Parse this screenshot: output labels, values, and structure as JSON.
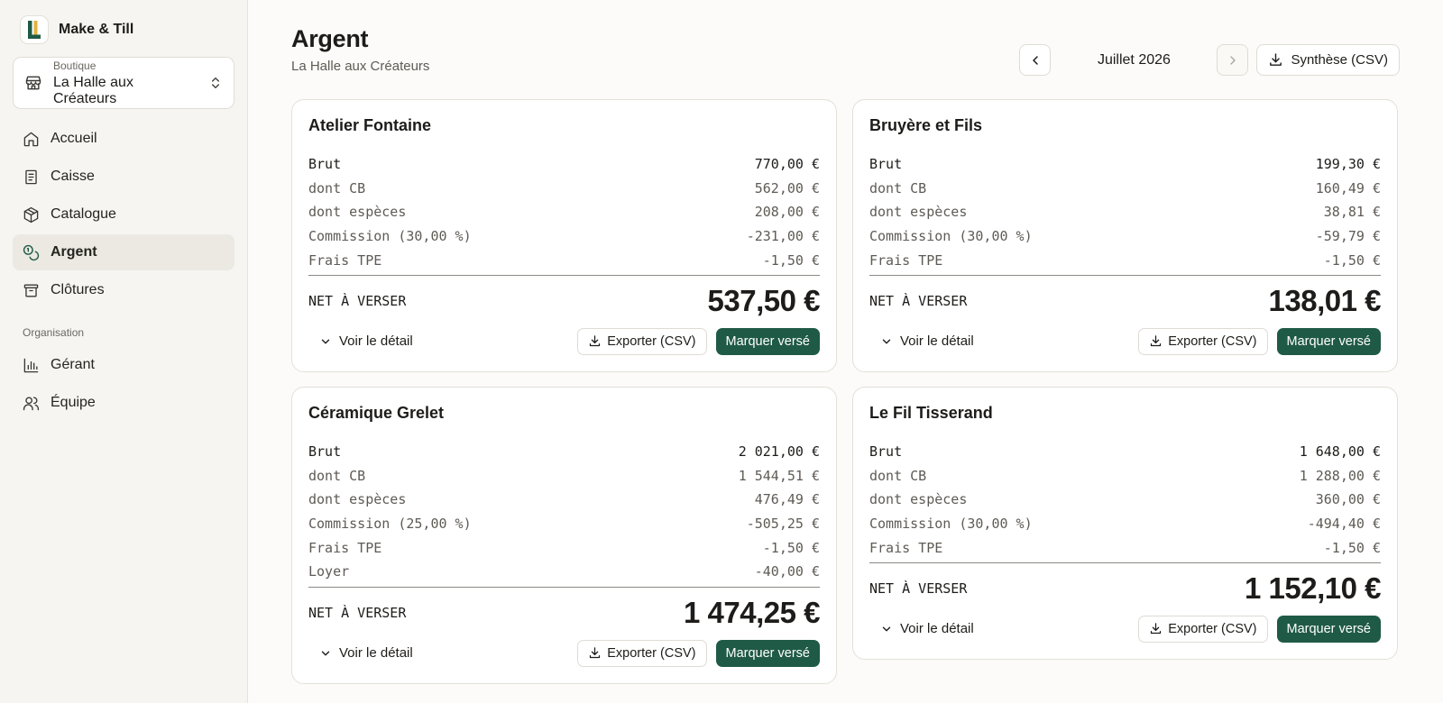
{
  "app": {
    "name": "Make & Till"
  },
  "shop": {
    "label": "Boutique",
    "value": "La Halle aux Créateurs"
  },
  "nav": {
    "items": [
      {
        "label": "Accueil"
      },
      {
        "label": "Caisse"
      },
      {
        "label": "Catalogue"
      },
      {
        "label": "Argent"
      },
      {
        "label": "Clôtures"
      }
    ],
    "section_label": "Organisation",
    "org_items": [
      {
        "label": "Gérant"
      },
      {
        "label": "Équipe"
      }
    ]
  },
  "page": {
    "title": "Argent",
    "subtitle": "La Halle aux Créateurs"
  },
  "period": {
    "month": "Juillet 2026"
  },
  "summary_export": {
    "label": "Synthèse (CSV)"
  },
  "labels": {
    "net": "NET À VERSER",
    "detail": "Voir le détail",
    "export": "Exporter (CSV)",
    "mark_paid": "Marquer versé"
  },
  "cards": [
    {
      "name": "Atelier Fontaine",
      "rows": [
        {
          "label": "Brut",
          "value": "770,00 €"
        },
        {
          "label": "dont CB",
          "value": "562,00 €"
        },
        {
          "label": "dont espèces",
          "value": "208,00 €"
        },
        {
          "label": "Commission (30,00 %)",
          "value": "-231,00 €"
        },
        {
          "label": "Frais TPE",
          "value": "-1,50 €"
        }
      ],
      "net": "537,50 €"
    },
    {
      "name": "Bruyère et Fils",
      "rows": [
        {
          "label": "Brut",
          "value": "199,30 €"
        },
        {
          "label": "dont CB",
          "value": "160,49 €"
        },
        {
          "label": "dont espèces",
          "value": "38,81 €"
        },
        {
          "label": "Commission (30,00 %)",
          "value": "-59,79 €"
        },
        {
          "label": "Frais TPE",
          "value": "-1,50 €"
        }
      ],
      "net": "138,01 €"
    },
    {
      "name": "Céramique Grelet",
      "rows": [
        {
          "label": "Brut",
          "value": "2 021,00 €"
        },
        {
          "label": "dont CB",
          "value": "1 544,51 €"
        },
        {
          "label": "dont espèces",
          "value": "476,49 €"
        },
        {
          "label": "Commission (25,00 %)",
          "value": "-505,25 €"
        },
        {
          "label": "Frais TPE",
          "value": "-1,50 €"
        },
        {
          "label": "Loyer",
          "value": "-40,00 €"
        }
      ],
      "net": "1 474,25 €"
    },
    {
      "name": "Le Fil Tisserand",
      "rows": [
        {
          "label": "Brut",
          "value": "1 648,00 €"
        },
        {
          "label": "dont CB",
          "value": "1 288,00 €"
        },
        {
          "label": "dont espèces",
          "value": "360,00 €"
        },
        {
          "label": "Commission (30,00 %)",
          "value": "-494,40 €"
        },
        {
          "label": "Frais TPE",
          "value": "-1,50 €"
        }
      ],
      "net": "1 152,10 €"
    }
  ],
  "colors": {
    "accent": "#1f5a46",
    "sidebar_bg": "#f6f5f1",
    "page_bg": "#fcfbf9"
  },
  "icons": {
    "nav": [
      "home-icon",
      "receipt-icon",
      "package-icon",
      "coins-icon",
      "archive-icon"
    ],
    "org": [
      "bar-chart-icon",
      "users-icon"
    ]
  }
}
